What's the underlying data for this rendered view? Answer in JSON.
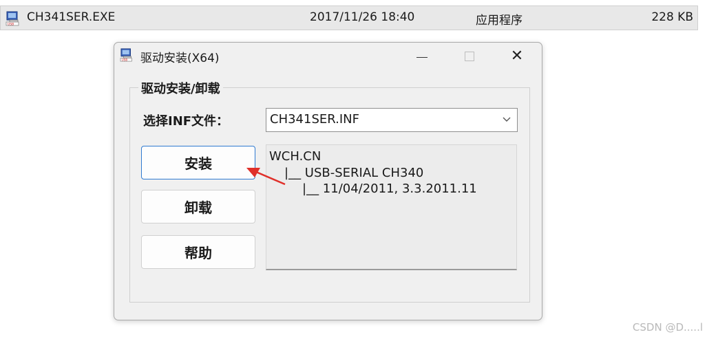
{
  "file_row": {
    "name": "CH341SER.EXE",
    "modified": "2017/11/26 18:40",
    "type": "应用程序",
    "size": "228 KB"
  },
  "dialog": {
    "title": "驱动安装(X64)",
    "group_title": "驱动安装/卸载",
    "inf_label": "选择INF文件：",
    "inf_selected": "CH341SER.INF",
    "buttons": {
      "install": "安装",
      "uninstall": "卸载",
      "help": "帮助"
    },
    "info_lines": [
      "WCH.CN",
      "|__ USB-SERIAL CH340",
      "|__ 11/04/2011, 3.3.2011.11"
    ]
  },
  "window_controls": {
    "minimize": "minimize-icon",
    "maximize": "maximize-icon",
    "close": "close-icon"
  },
  "annotation": {
    "arrow_color": "#e0302a"
  },
  "watermark": "CSDN @D.....l",
  "colors": {
    "focus_border": "#2f7ad1",
    "dialog_bg": "#f0f0f0"
  }
}
